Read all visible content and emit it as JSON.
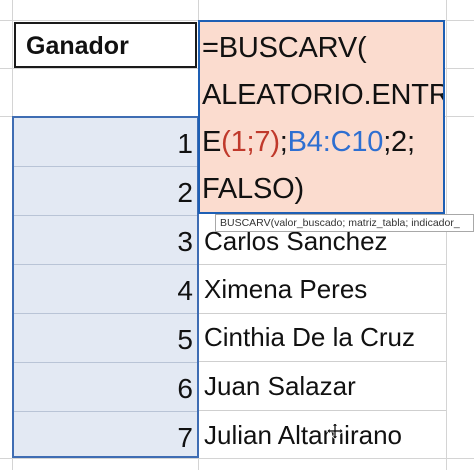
{
  "header": {
    "label": "Ganador"
  },
  "formula": {
    "line1": "=BUSCARV(",
    "line2": "ALEATORIO.ENTR",
    "line3_prefix": "E",
    "line3_red": "(1;7)",
    "line3_sep": ";",
    "line3_blue": "B4:C10",
    "line3_suffix": ";2;",
    "line4": "FALSO)"
  },
  "tooltip": {
    "text": "BUSCARV(valor_buscado; matriz_tabla; indicador_"
  },
  "rows": [
    {
      "number": "1",
      "name": ""
    },
    {
      "number": "2",
      "name": ""
    },
    {
      "number": "3",
      "name": "Carlos Sanchez"
    },
    {
      "number": "4",
      "name": "Ximena Peres"
    },
    {
      "number": "5",
      "name": "Cinthia De la Cruz"
    },
    {
      "number": "6",
      "name": "Juan Salazar"
    },
    {
      "number": "7",
      "name": "Julian Altamirano"
    }
  ],
  "colors": {
    "formula_bg": "#fbdccf",
    "formula_border": "#1e5fb4",
    "range_bg": "#e3e9f3",
    "range_border": "#3f6db3",
    "ref_red": "#c0392b",
    "ref_blue": "#2e6fd1"
  },
  "icons": {
    "cursor": "move-cursor-icon"
  }
}
